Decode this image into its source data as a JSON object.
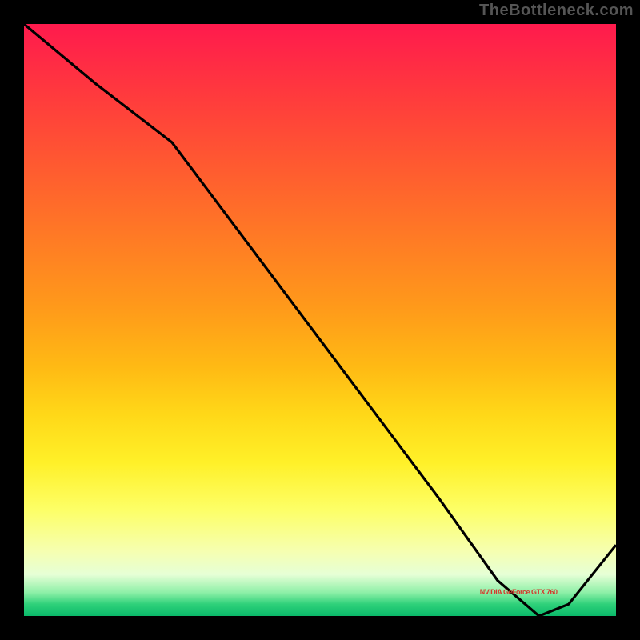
{
  "attribution": "TheBottleneck.com",
  "line_label": "NVIDIA GeForce GTX 760",
  "line_label_pos": {
    "left_pct": 77,
    "top_pct": 95.3
  },
  "colors": {
    "curve_stroke": "#000000",
    "label": "#d33a2e",
    "attribution": "#555555",
    "gradient_top": "#ff1a4d",
    "gradient_bottom": "#0ab96a"
  },
  "chart_data": {
    "type": "line",
    "title": "",
    "xlabel": "",
    "ylabel": "",
    "xlim": [
      0,
      100
    ],
    "ylim": [
      0,
      100
    ],
    "series": [
      {
        "name": "bottleneck-curve",
        "x": [
          0,
          12,
          25,
          40,
          55,
          70,
          80,
          87,
          92,
          100
        ],
        "values": [
          100,
          90,
          80,
          60,
          40,
          20,
          6,
          0,
          2,
          12
        ]
      }
    ],
    "annotations": [
      {
        "text": "NVIDIA GeForce GTX 760",
        "x": 84,
        "y": 2
      }
    ]
  }
}
